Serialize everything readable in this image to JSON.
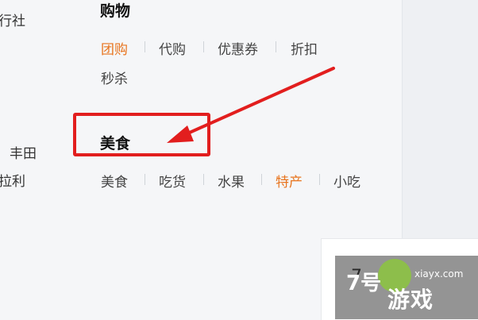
{
  "left_column": {
    "items": [
      "行社",
      "丰田",
      "拉利"
    ]
  },
  "shopping": {
    "title": "购物",
    "links": [
      {
        "label": "团购",
        "active": true
      },
      {
        "label": "代购",
        "active": false
      },
      {
        "label": "优惠券",
        "active": false
      },
      {
        "label": "折扣",
        "active": false
      },
      {
        "label": "秒杀",
        "active": false
      }
    ]
  },
  "food": {
    "title": "美食",
    "links": [
      {
        "label": "美食",
        "active": false
      },
      {
        "label": "吃货",
        "active": false
      },
      {
        "label": "水果",
        "active": false
      },
      {
        "label": "特产",
        "active": true
      },
      {
        "label": "小吃",
        "active": false
      }
    ]
  },
  "bottom_box": {
    "text": "7"
  },
  "annotation": {
    "color": "#e21e1e"
  },
  "watermark": {
    "big": "游戏",
    "small": "xiayx.com",
    "icon": "7号"
  },
  "colors": {
    "accent": "#e8741e",
    "text": "#444444",
    "title": "#111111"
  }
}
